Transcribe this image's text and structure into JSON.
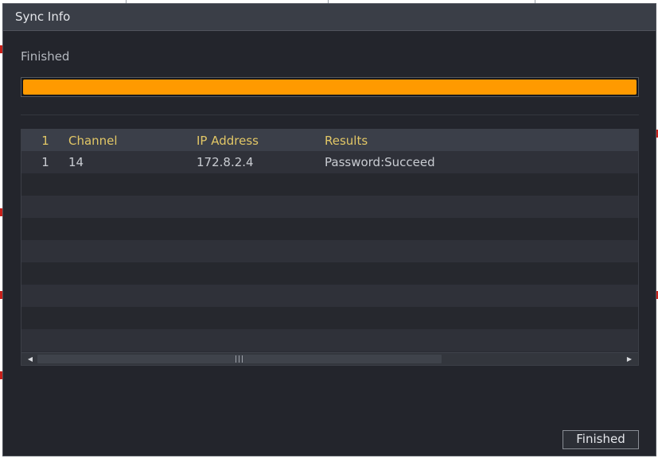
{
  "dialog": {
    "title": "Sync Info",
    "status": "Finished",
    "progress_fraction": 1.0,
    "progress_color": "#ff9a00"
  },
  "table": {
    "headers": {
      "index": "1",
      "channel": "Channel",
      "ip": "IP Address",
      "results": "Results"
    },
    "rows": [
      {
        "index": "1",
        "channel": "14",
        "ip": "172.8.2.4",
        "results": "Password:Succeed"
      }
    ]
  },
  "scrollbar": {
    "left_icon": "triangle-left-icon",
    "right_icon": "triangle-right-icon",
    "left_glyph": "◀",
    "right_glyph": "▶"
  },
  "footer": {
    "finished_label": "Finished"
  },
  "colors": {
    "header_text": "#e2c766",
    "accent": "#ff9a00",
    "dialog_bg": "#23252c"
  }
}
